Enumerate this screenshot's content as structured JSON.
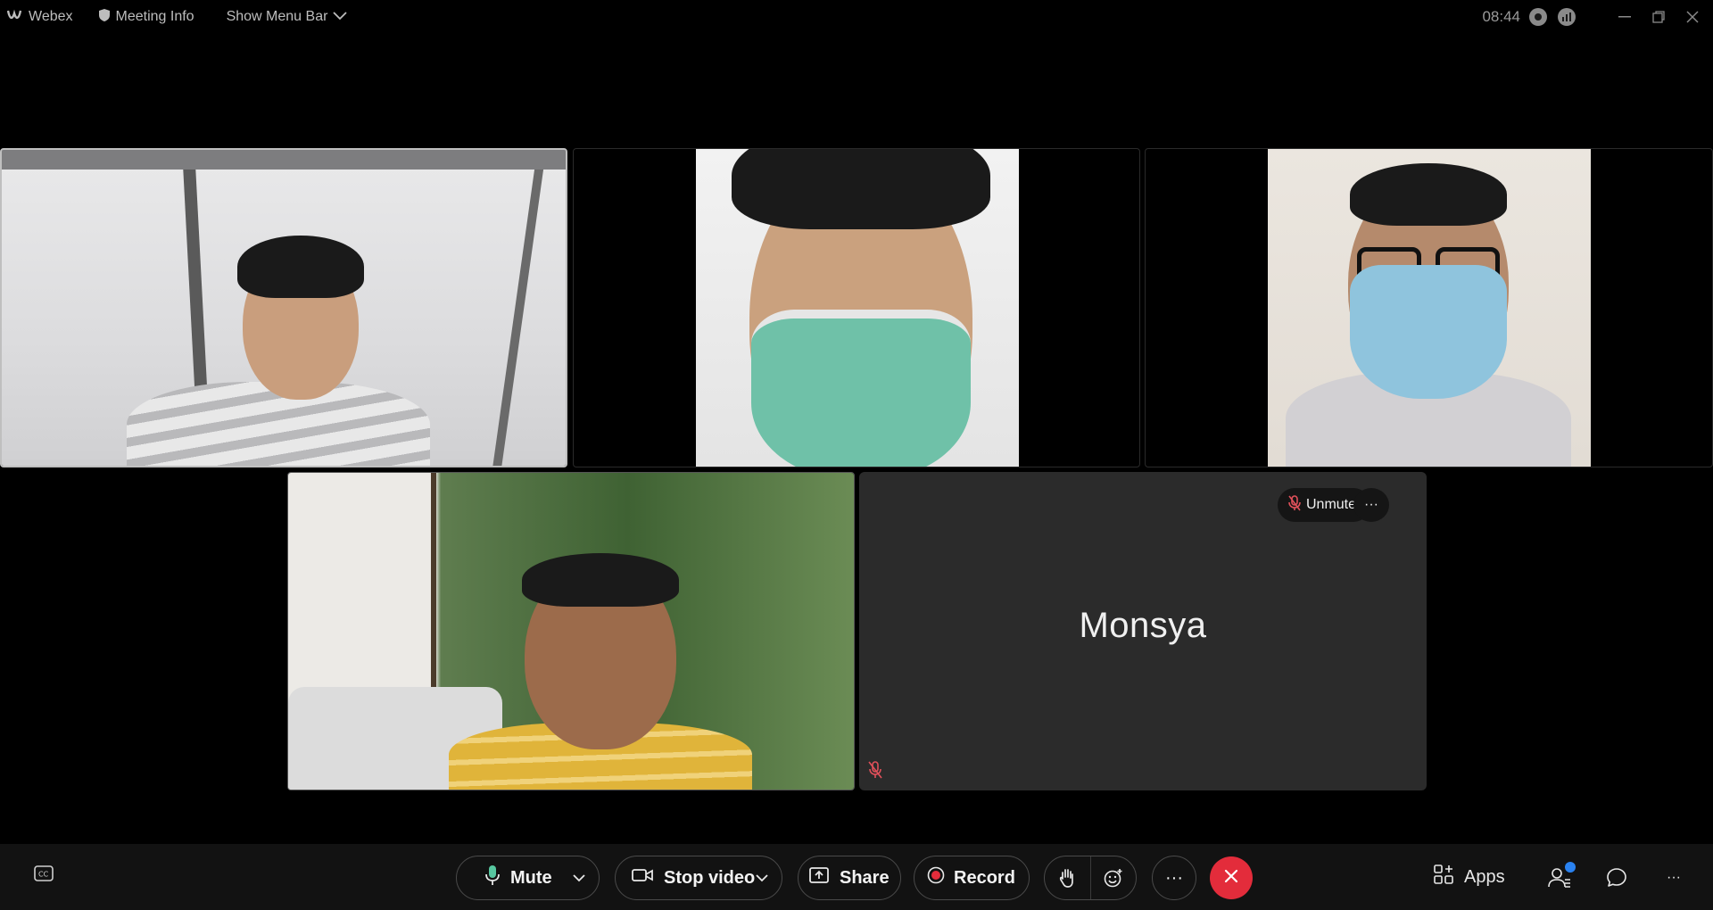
{
  "titlebar": {
    "app_name": "Webex",
    "meeting_info": "Meeting Info",
    "show_menu_bar": "Show Menu Bar",
    "time": "08:44"
  },
  "participants": {
    "p5_name": "Monsya",
    "unmute_label": "Unmute",
    "more_label": "···"
  },
  "toolbar": {
    "mute_label": "Mute",
    "stop_video_label": "Stop video",
    "share_label": "Share",
    "record_label": "Record",
    "more_label": "···",
    "apps_label": "Apps"
  },
  "colors": {
    "leave": "#e32c3b",
    "badge": "#2a82f0",
    "muted_icon": "#e0505a"
  },
  "icons": [
    "webex-logo-icon",
    "shield-icon",
    "chevron-down-icon",
    "record-status-icon",
    "stats-icon",
    "minimize-icon",
    "restore-icon",
    "close-icon",
    "mic-muted-icon",
    "more-icon",
    "captions-icon",
    "mic-icon",
    "video-icon",
    "share-icon",
    "record-icon",
    "raise-hand-icon",
    "reactions-icon",
    "leave-icon",
    "apps-icon",
    "participants-icon",
    "chat-icon"
  ]
}
